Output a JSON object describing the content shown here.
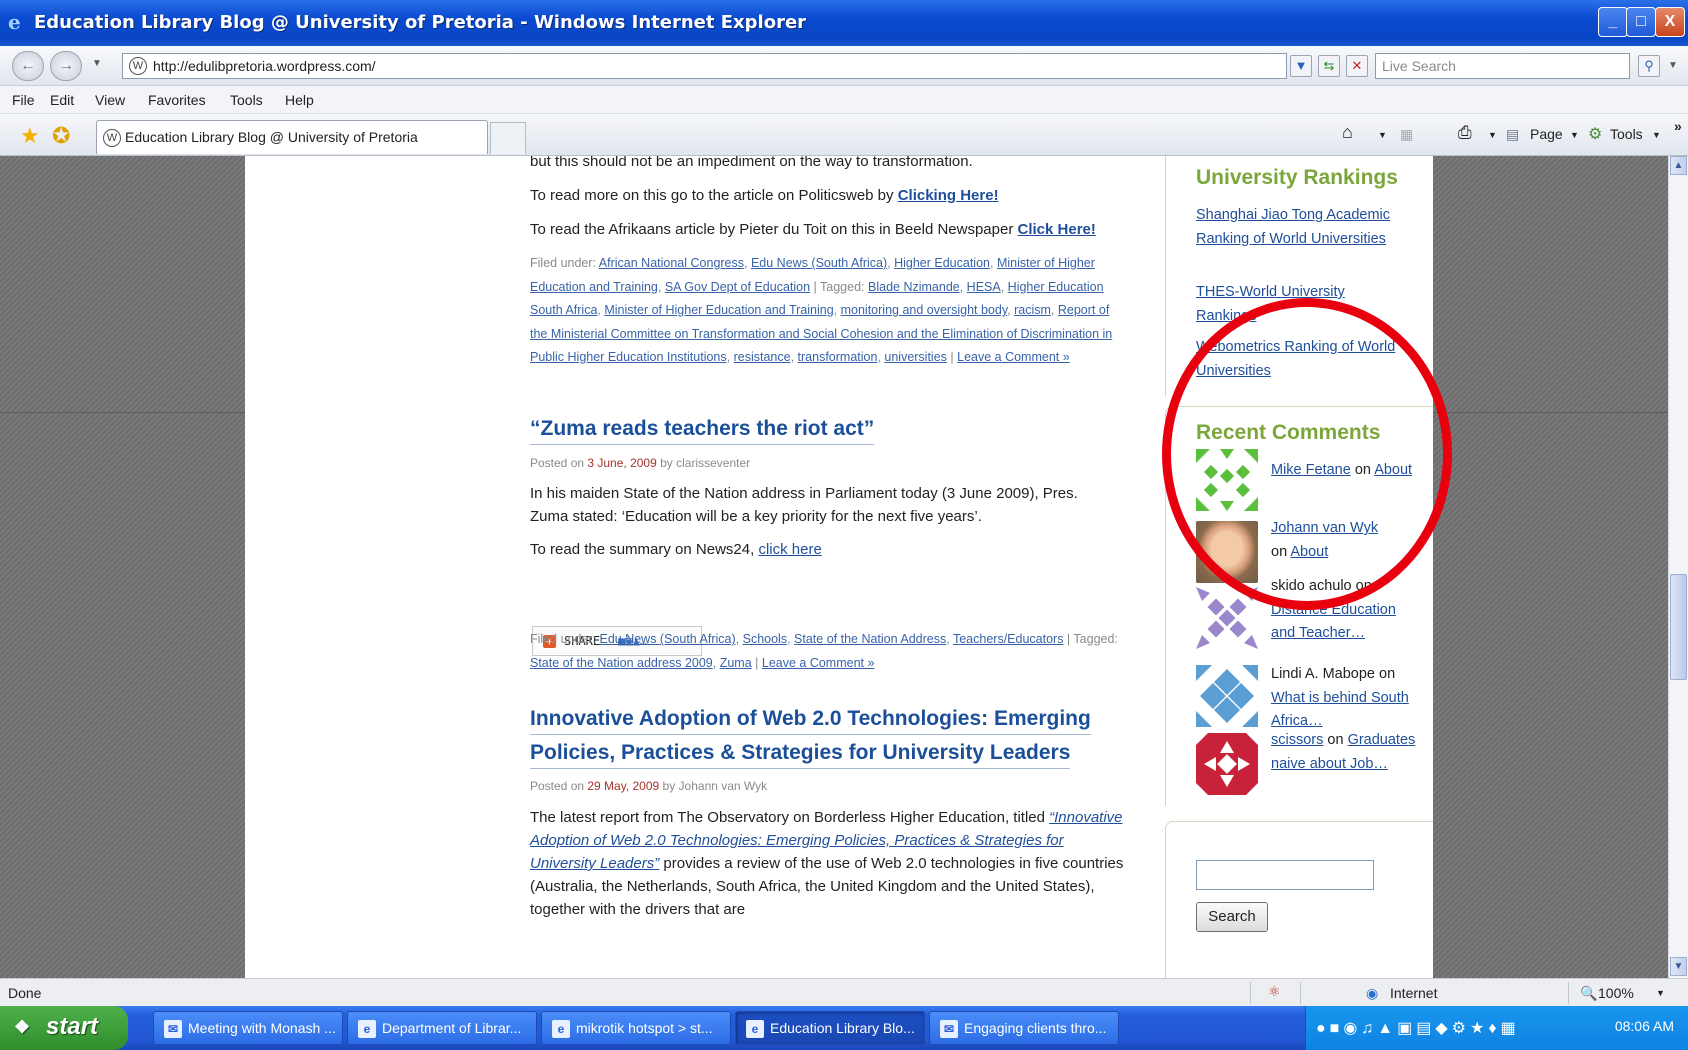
{
  "window": {
    "title": "Education Library Blog @ University of Pretoria - Windows Internet Explorer",
    "controls": [
      "_",
      "□",
      "X"
    ]
  },
  "address_bar": {
    "url": "http://edulibpretoria.wordpress.com/",
    "search_placeholder": "Live Search"
  },
  "menu": [
    "File",
    "Edit",
    "View",
    "Favorites",
    "Tools",
    "Help"
  ],
  "tab": {
    "label": "Education Library Blog @ University of Pretoria"
  },
  "command_bar": {
    "page": "Page",
    "tools": "Tools"
  },
  "content": {
    "p1": "but this should not be an impediment on the way to transformation.",
    "p2_text": "To read more on this go to the article on Politicsweb by ",
    "p2_link": "Clicking Here!",
    "p3_text": "To read the Afrikaans article by Pieter du Toit on this in Beeld Newspaper ",
    "p3_link": "Click Here!",
    "filed1": {
      "filed_under": "Filed under: ",
      "categories": [
        "African National Congress",
        "Edu News (South Africa)",
        "Higher Education",
        "Minister of Higher Education and Training",
        "SA Gov Dept of Education"
      ],
      "tagged": " | Tagged: ",
      "tags": [
        "Blade Nzimande",
        "HESA",
        "Higher Education South Africa",
        "Minister of Higher Education and Training",
        "monitoring and oversight body",
        "racism",
        "Report of the Ministerial Committee on Transformation and Social Cohesion and the Elimination of Discrimination in Public Higher Education Institutions",
        "resistance",
        "transformation",
        "universities"
      ],
      "comment": "Leave a Comment »"
    },
    "post2": {
      "title": "“Zuma reads teachers the riot act”",
      "posted_on": "Posted on ",
      "date": "3 June, 2009",
      "by": " by clarisseventer",
      "body1": "In his maiden State of the Nation address in Parliament today (3 June 2009), Pres. Zuma stated: ‘Education will be a key priority for the next five years’.",
      "body2_text": "To read the summary on News24, ",
      "body2_link": "click here",
      "share": "SHARE",
      "filed_under": "Filed under: ",
      "categories": [
        "Edu News (South Africa)",
        "Schools",
        "State of the Nation Address",
        "Teachers/Educators"
      ],
      "tagged": " | Tagged: ",
      "tags": [
        "State of the Nation address 2009",
        "Zuma"
      ],
      "comment": "Leave a Comment »"
    },
    "post3": {
      "title_line1": "Innovative Adoption of Web 2.0 Technologies: Emerging",
      "title_line2": "Policies, Practices & Strategies for University Leaders",
      "posted_on": "Posted on ",
      "date": "29 May, 2009",
      "by": " by Johann van Wyk",
      "body_start": "The latest report from The Observatory on Borderless Higher Education, titled ",
      "body_link": "“Innovative Adoption of Web 2.0 Technologies: Emerging Policies, Practices & Strategies for University Leaders”",
      "body_end": " provides a review of the use of Web 2.0 technologies in five countries (Australia, the Netherlands, South Africa, the United Kingdom and the United States), together with the drivers that are"
    }
  },
  "sidebar": {
    "rankings": {
      "title": "University Rankings",
      "links": [
        "Shanghai Jiao Tong Academic Ranking of World Universities",
        "THES-World University Rankings",
        "Webometrics Ranking of World Universities"
      ]
    },
    "comments": {
      "title": "Recent Comments",
      "items": [
        {
          "author": "Mike Fetane",
          "on": " on ",
          "post": "About"
        },
        {
          "author": "Johann van Wyk",
          "on": "on ",
          "post": "About"
        },
        {
          "author": "skido achulo",
          "on": " on ",
          "post": "Distance Education and Teacher…"
        },
        {
          "author": "Lindi A. Mabope",
          "on": " on ",
          "post": "What is behind South Africa…"
        },
        {
          "author": "scissors",
          "on": " on ",
          "post": "Graduates naive about Job…"
        }
      ]
    },
    "search_button": "Search"
  },
  "status": {
    "left": "Done",
    "zone": "Internet",
    "zoom": "100%"
  },
  "taskbar": {
    "start": "start",
    "tasks": [
      "Meeting with Monash ...",
      "Department of Librar...",
      "mikrotik hotspot > st...",
      "Education Library Blo...",
      "Engaging clients thro..."
    ],
    "clock": "08:06 AM"
  },
  "colors": {
    "title_bar": "#0846c4",
    "link": "#1f4f9a",
    "widget_title": "#7ba63b",
    "annotation_circle": "#e8000e"
  }
}
